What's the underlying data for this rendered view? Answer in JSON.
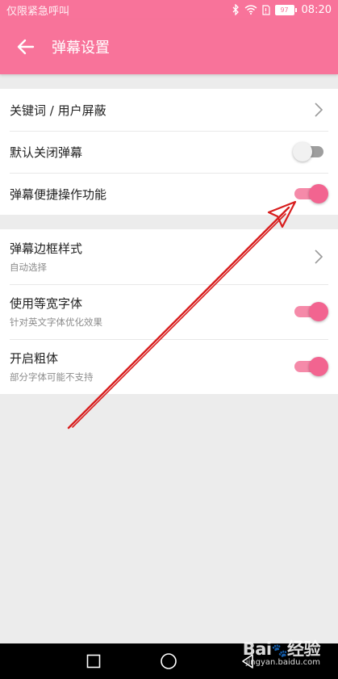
{
  "status_bar": {
    "left_text": "仅限紧急呼叫",
    "battery": "97",
    "time": "08:20",
    "icons": [
      "bluetooth-icon",
      "wifi-icon",
      "sim-icon",
      "battery-icon"
    ]
  },
  "app_bar": {
    "title": "弹幕设置",
    "back_icon": "arrow-left-icon"
  },
  "group1": {
    "rows": [
      {
        "label": "关键词 / 用户屏蔽",
        "control": "chevron"
      },
      {
        "label": "默认关闭弹幕",
        "control": "toggle",
        "on": false
      },
      {
        "label": "弹幕便捷操作功能",
        "control": "toggle",
        "on": true
      }
    ]
  },
  "group2": {
    "rows": [
      {
        "label": "弹幕边框样式",
        "sublabel": "自动选择",
        "control": "chevron"
      },
      {
        "label": "使用等宽字体",
        "sublabel": "针对英文字体优化效果",
        "control": "toggle",
        "on": true
      },
      {
        "label": "开启粗体",
        "sublabel": "部分字体可能不支持",
        "control": "toggle",
        "on": true
      }
    ]
  },
  "colors": {
    "accent": "#f8739a",
    "toggle_on_knob": "#f26490",
    "toggle_on_track": "#f58aa9",
    "toggle_off_track": "#9e9e9e",
    "annotation_arrow": "#d81e1e",
    "background": "#ececec"
  },
  "nav_bar": {
    "icons": [
      "square-recent-icon",
      "circle-home-icon",
      "triangle-back-icon"
    ]
  },
  "watermark": {
    "brand_left": "Bai",
    "brand_right": "经验",
    "site": "jingyan.baidu.com"
  }
}
